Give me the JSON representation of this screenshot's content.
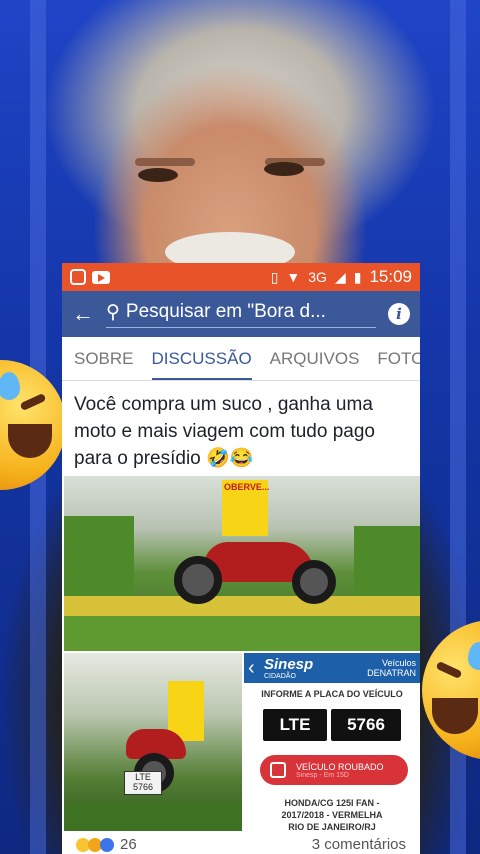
{
  "status_bar": {
    "network": "3G",
    "time": "15:09"
  },
  "search": {
    "text": "Pesquisar em \"Bora d..."
  },
  "tabs": [
    {
      "label": "SOBRE",
      "active": false
    },
    {
      "label": "DISCUSSÃO",
      "active": true
    },
    {
      "label": "ARQUIVOS",
      "active": false
    },
    {
      "label": "FOTO",
      "active": false
    }
  ],
  "post": {
    "text": "Você compra um suco , ganha uma moto e mais viagem com tudo pago para o presídio 🤣😂"
  },
  "photo_main": {
    "sign_text": "OBERVE..."
  },
  "photo_left": {
    "plate": "LTE 5766"
  },
  "sinesp": {
    "brand": "Sinesp",
    "brand_sub": "CIDADÃO",
    "header_right_1": "Veículos",
    "header_right_2": "DENATRAN",
    "prompt": "INFORME A PLACA DO VEÍCULO",
    "plate_letters": "LTE",
    "plate_numbers": "5766",
    "status": "VEÍCULO ROUBADO",
    "status_sub": "Sinesp - Em 15D",
    "model": "HONDA/CG 125I FAN -",
    "year_color": "2017/2018 - VERMELHA",
    "location": "RIO DE JANEIRO/RJ"
  },
  "reactions": {
    "count": "26",
    "comments": "3 comentários"
  },
  "colors": {
    "status_bar": "#e8532a",
    "facebook_blue": "#3b5998",
    "sinesp_blue": "#1d5fa8",
    "stolen_red": "#d9333a"
  }
}
